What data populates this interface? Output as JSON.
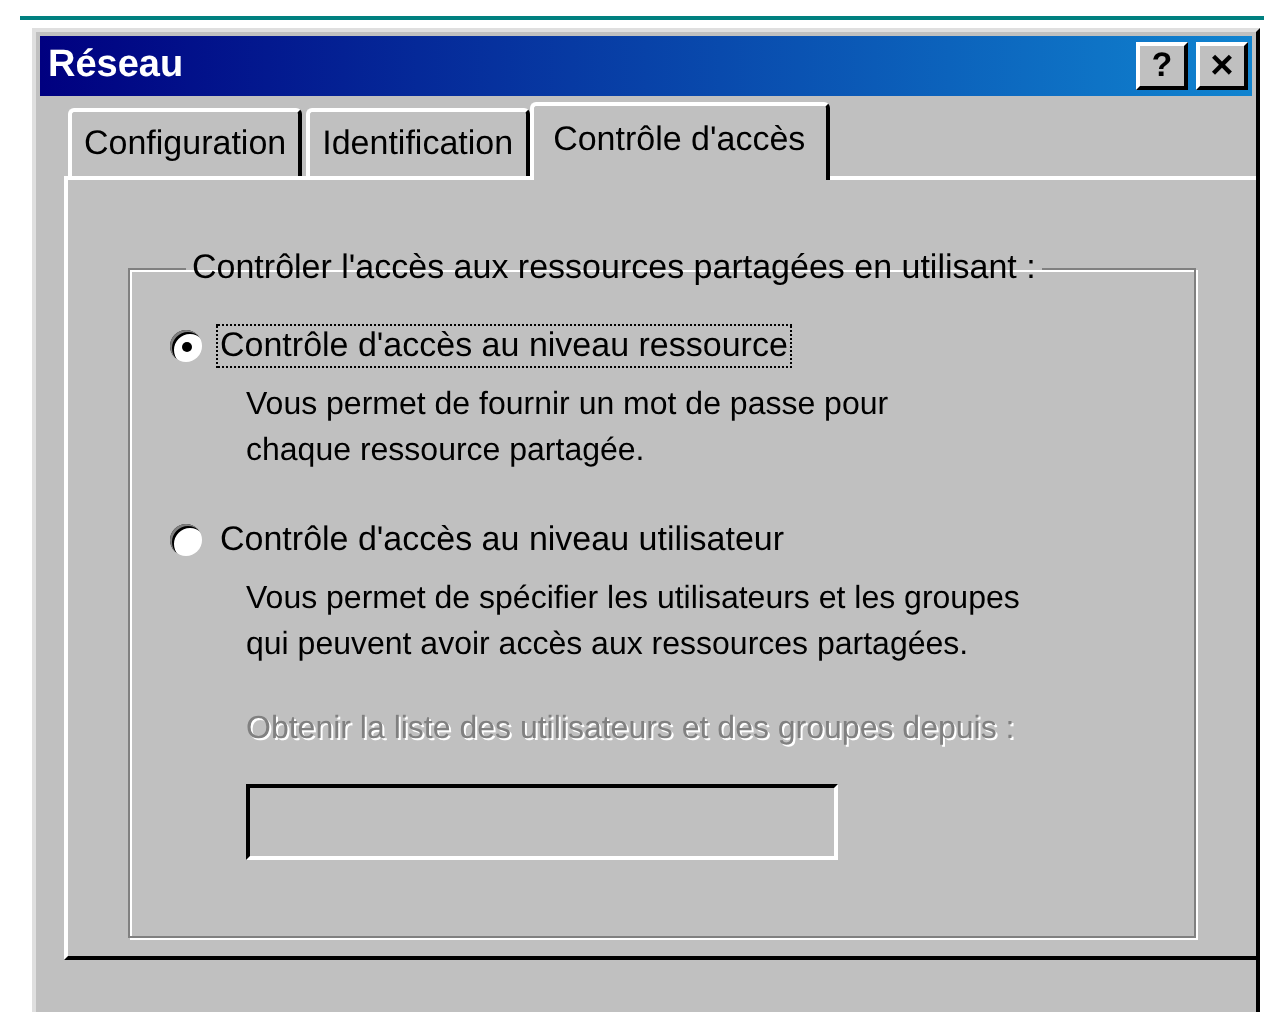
{
  "window": {
    "title": "Réseau",
    "buttons": [
      {
        "kind": "help",
        "label": "?"
      },
      {
        "kind": "close",
        "label": "×"
      }
    ]
  },
  "tabs": [
    {
      "label": "Configuration",
      "selected": false
    },
    {
      "label": "Identification",
      "selected": false
    },
    {
      "label": "Contrôle d'accès",
      "selected": true
    }
  ],
  "group": {
    "legend": "Contrôler l'accès aux ressources partagées en utilisant :",
    "options": [
      {
        "label": "Contrôle d'accès au niveau ressource",
        "description": [
          "Vous permet de fournir un mot de passe pour",
          "chaque ressource partagée."
        ],
        "selected": true,
        "focused": true
      },
      {
        "label": "Contrôle d'accès au niveau utilisateur",
        "description": [
          "Vous permet de spécifier les utilisateurs et les groupes",
          "qui peuvent avoir accès aux ressources partagées."
        ],
        "selected": false,
        "focused": false
      }
    ],
    "source": {
      "label": "Obtenir la liste des utilisateurs et des groupes depuis :",
      "disabled": true
    }
  }
}
